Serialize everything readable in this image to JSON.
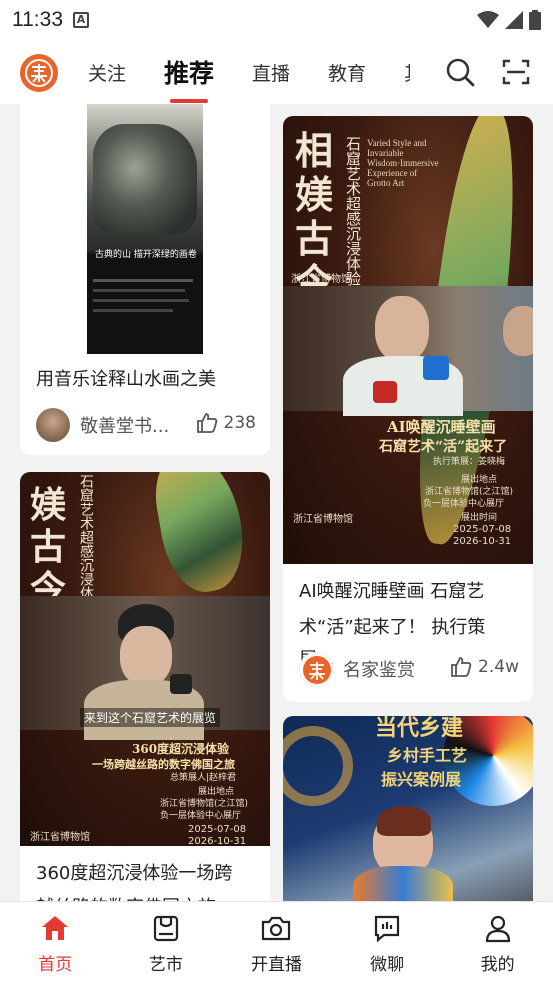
{
  "status_bar": {
    "time": "11:33",
    "notification_icon": "A"
  },
  "top_nav": {
    "tabs": [
      {
        "label": "关注",
        "active": false
      },
      {
        "label": "推荐",
        "active": true
      },
      {
        "label": "直播",
        "active": false
      },
      {
        "label": "教育",
        "active": false
      },
      {
        "label": "其",
        "active": false
      }
    ],
    "accent_color": "#e53935",
    "logo_color": "#e8642b"
  },
  "feed": {
    "cards": [
      {
        "title": "用音乐诠释山水画之美",
        "author": "敬善堂书...",
        "likes": "238",
        "image": {
          "caption": "古典的山 描开深绿的画卷"
        }
      },
      {
        "title": "AI唤醒沉睡壁画 石窟艺术“活”起来了！ 执行策展...",
        "title_line1": "AI唤醒沉睡壁画 石窟艺",
        "title_line2": "术“活”起来了！ 执行策展...",
        "author": "名家鉴赏",
        "likes": "2.4w",
        "image": {
          "big_chars": [
            "相",
            "媄",
            "古",
            "今"
          ],
          "vertical_title": "石窟艺术超感沉浸体验",
          "english": "Varied Style and Invariable Wisdom·Immersive Experience of Grotto Art",
          "museum": "浙江省博物馆",
          "banner_line1": "AI唤醒沉睡壁画",
          "banner_line2": "石窟艺术“活”起来了",
          "curator": "执行策展：姜晓梅",
          "venue_title": "展出地点",
          "venue": "浙江省博物馆(之江馆)",
          "venue_detail": "负一层体验中心展厅",
          "date_title": "展出时间",
          "date_start": "2025-07-08",
          "date_end": "2026-10-31"
        }
      },
      {
        "title": "360度超沉浸体验一场跨",
        "title_line2": "越丝路的数字佛国之旅",
        "image": {
          "big_chars": [
            "媄",
            "古",
            "今"
          ],
          "vertical_title": "石窟艺术超感沉浸体验",
          "subtitle": "来到这个石窟艺术的展览",
          "banner_line1": "360度超沉浸体验",
          "banner_line2": "一场跨越丝路的数字佛国之旅",
          "curator": "总策展人|赵梓君",
          "venue_title": "展出地点",
          "venue": "浙江省博物馆(之江馆)",
          "venue_detail": "负一层体验中心展厅",
          "date_title": "展出时间",
          "date_start": "2025-07-08",
          "date_end": "2026-10-31",
          "museum": "浙江省博物馆"
        }
      },
      {
        "image": {
          "headline1": "当代乡建",
          "headline2": "乡村手工艺",
          "headline3": "振兴案例展"
        }
      }
    ]
  },
  "bottom_nav": {
    "items": [
      {
        "label": "首页",
        "icon": "home-icon",
        "active": true
      },
      {
        "label": "艺市",
        "icon": "market-icon",
        "active": false
      },
      {
        "label": "开直播",
        "icon": "camera-icon",
        "active": false
      },
      {
        "label": "微聊",
        "icon": "chat-icon",
        "active": false
      },
      {
        "label": "我的",
        "icon": "profile-icon",
        "active": false
      }
    ]
  }
}
